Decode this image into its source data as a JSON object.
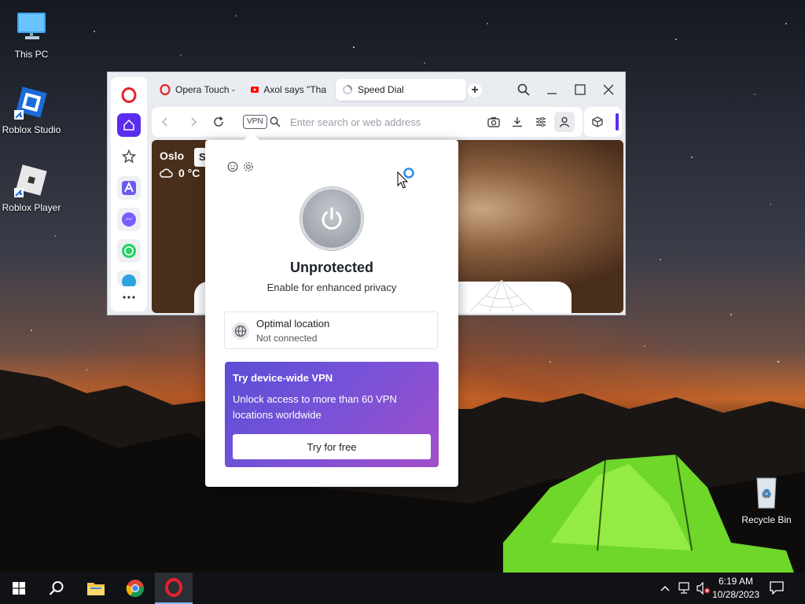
{
  "desktop": {
    "icons": [
      {
        "label": "This PC"
      },
      {
        "label": "Roblox Studio"
      },
      {
        "label": "Roblox Player"
      },
      {
        "label": "Recycle Bin"
      }
    ]
  },
  "browser": {
    "tabs": [
      {
        "label": "Opera Touch - "
      },
      {
        "label": "Axol says \"Tha"
      },
      {
        "label": "Speed Dial"
      }
    ],
    "address": {
      "vpn_badge": "VPN",
      "placeholder": "Enter search or web address"
    },
    "weather": {
      "city": "Oslo",
      "temperature": "0 °C",
      "badge_initial": "S"
    }
  },
  "vpn_popup": {
    "status_title": "Unprotected",
    "status_subtitle": "Enable for enhanced privacy",
    "location_title": "Optimal location",
    "location_status": "Not connected",
    "promo_title": "Try device-wide VPN",
    "promo_text": "Unlock access to more than 60 VPN locations worldwide",
    "promo_button": "Try for free"
  },
  "taskbar": {
    "time": "6:19 AM",
    "date": "10/28/2023"
  },
  "colors": {
    "opera_red": "#e8202a",
    "home_active": "#5b2cf0",
    "promo_start": "#5a4fd6",
    "promo_end": "#a24fc8"
  }
}
